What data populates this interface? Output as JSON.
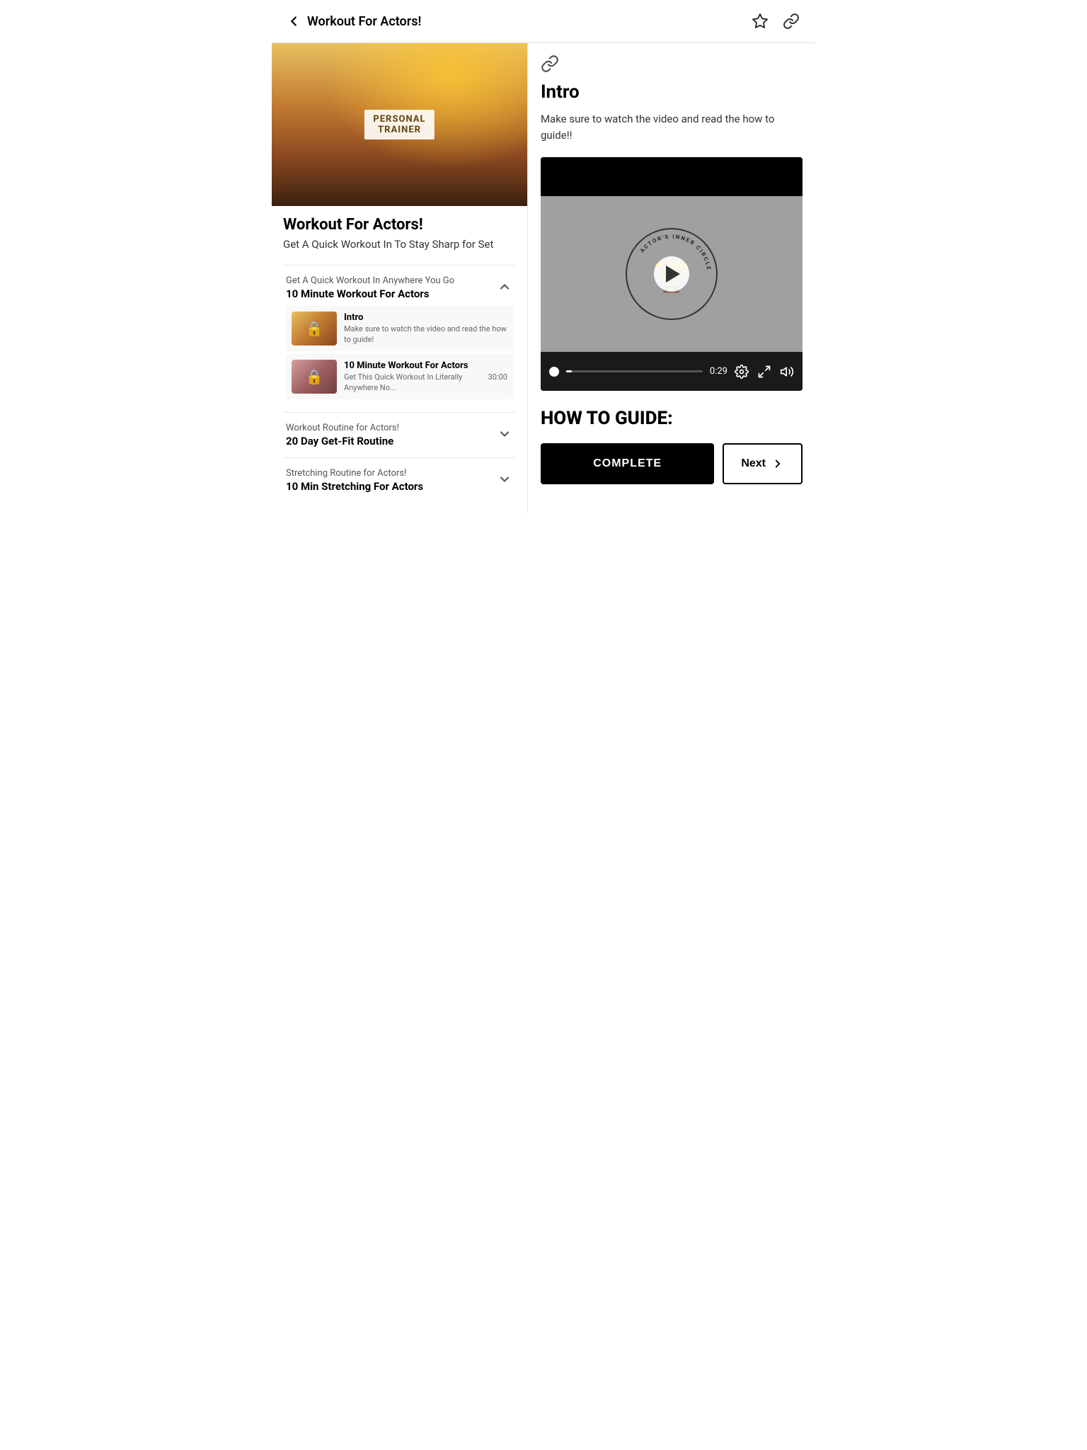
{
  "header": {
    "back_label": "Workout For Actors!",
    "back_icon": "chevron-left",
    "favorite_icon": "star",
    "share_icon": "link"
  },
  "left": {
    "hero_alt": "Personal Trainer workout image",
    "trainer_line1": "PERSONAL",
    "trainer_line2": "TRAINER",
    "course_title": "Workout For Actors!",
    "course_subtitle": "Get A Quick Workout In To Stay Sharp for Set",
    "accordions": [
      {
        "subtitle": "Get A Quick Workout In Anywhere You Go",
        "title": "10 Minute Workout For Actors",
        "expanded": true,
        "chevron": "chevron-up",
        "lessons": [
          {
            "id": "intro",
            "title": "Intro",
            "description": "Make sure to watch the video and read the how to guide!",
            "locked": true,
            "thumb_type": "intro",
            "duration": null
          },
          {
            "id": "10min-workout",
            "title": "10 Minute Workout For Actors",
            "description": "Get This Quick Workout In Literally Anywhere No...",
            "locked": true,
            "thumb_type": "workout",
            "duration": "30:00"
          }
        ]
      },
      {
        "subtitle": "Workout Routine for Actors!",
        "title": "20 Day Get-Fit Routine",
        "expanded": false,
        "chevron": "chevron-down",
        "lessons": []
      },
      {
        "subtitle": "Stretching Routine for Actors!",
        "title": "10 Min Stretching For Actors",
        "expanded": false,
        "chevron": "chevron-down",
        "lessons": []
      }
    ]
  },
  "right": {
    "link_icon": "link",
    "section_title": "Intro",
    "section_description": "Make sure to watch the video and read the how to guide!!",
    "video": {
      "time_elapsed": "0:29",
      "progress_percent": 4
    },
    "how_to_heading": "HOW TO GUIDE:",
    "buttons": {
      "complete_label": "COMPLETE",
      "next_label": "Next"
    }
  }
}
